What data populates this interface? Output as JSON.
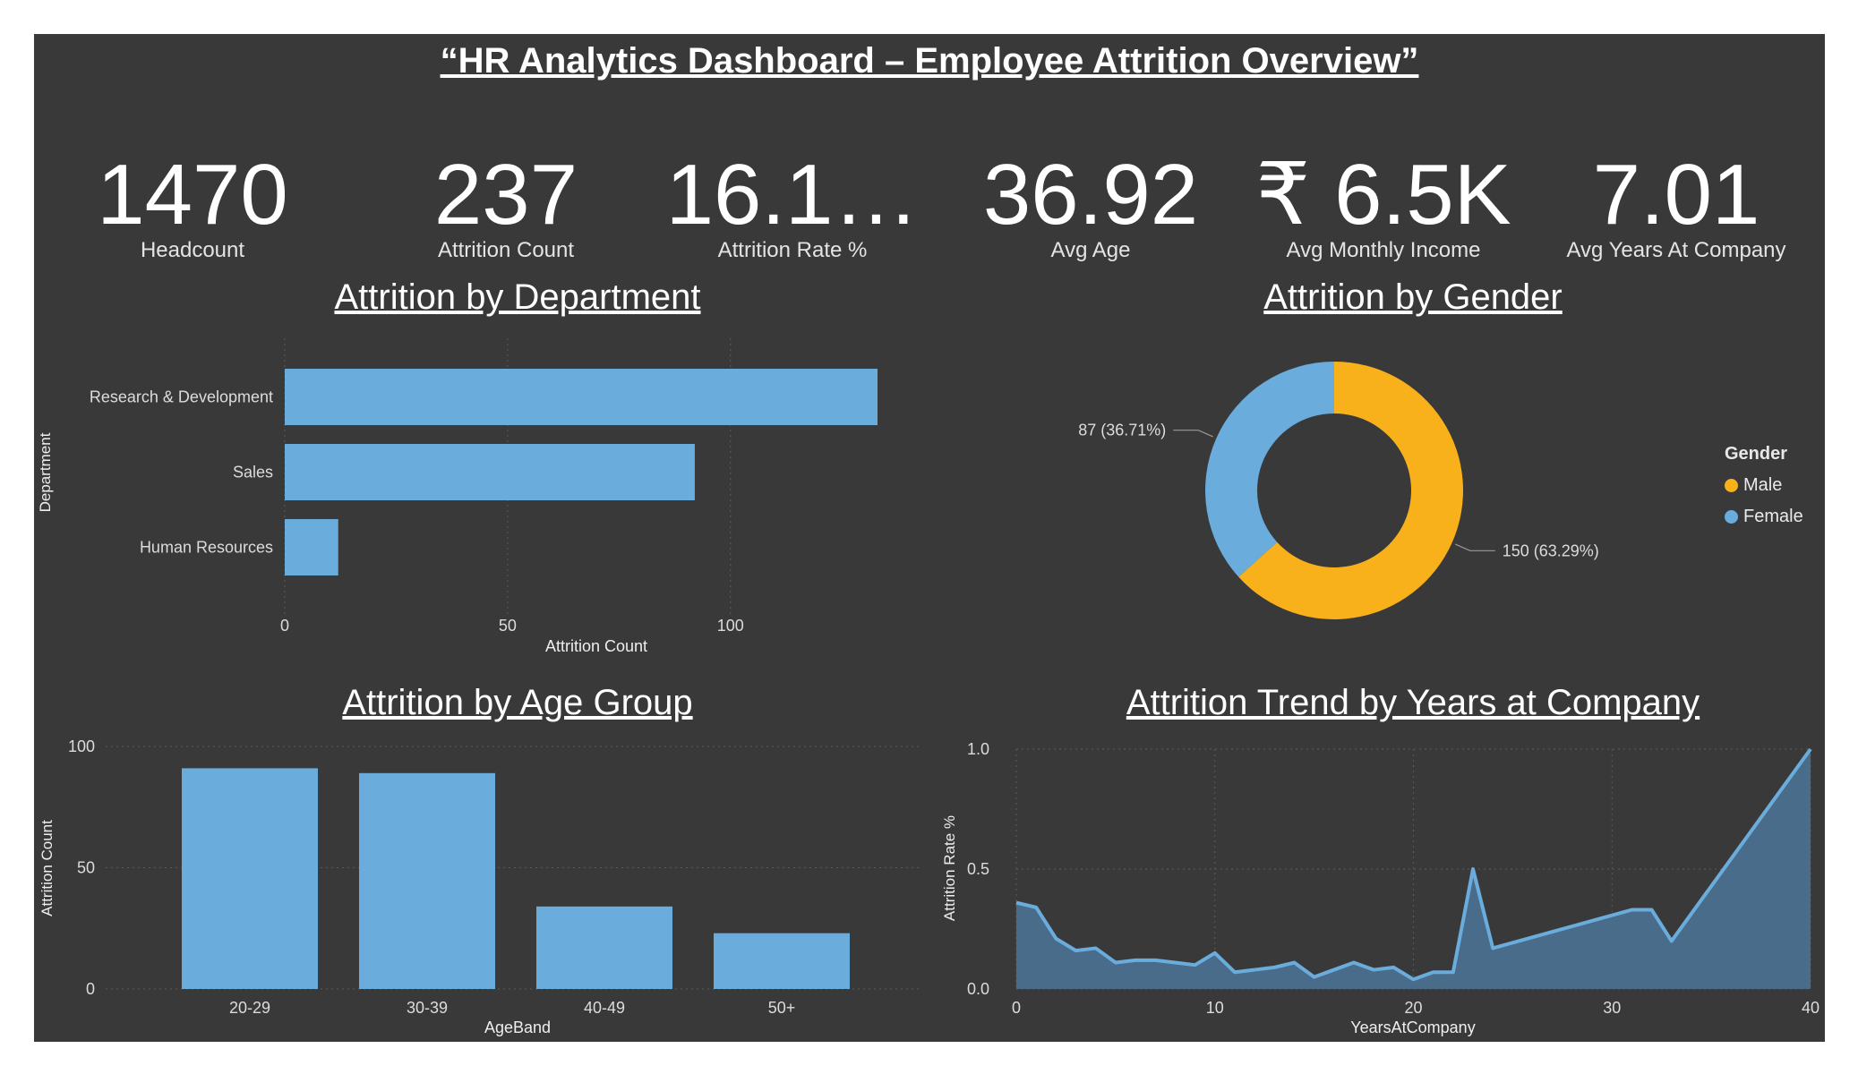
{
  "header": {
    "title": "“HR Analytics Dashboard – Employee Attrition Overview”"
  },
  "kpis": [
    {
      "value": "1470",
      "label": "Headcount"
    },
    {
      "value": "237",
      "label": "Attrition Count"
    },
    {
      "value": "16.1…",
      "label": "Attrition Rate %"
    },
    {
      "value": "36.92",
      "label": "Avg Age"
    },
    {
      "value": "₹ 6.5K",
      "label": "Avg Monthly Income"
    },
    {
      "value": "7.01",
      "label": "Avg Years At Company"
    }
  ],
  "colors": {
    "background": "#393939",
    "bar": "#6aacdc",
    "male": "#f9b11b",
    "female": "#6aacdc",
    "area": "#4a6f8e"
  },
  "chart_data": [
    {
      "type": "bar",
      "orientation": "horizontal",
      "title": "Attrition by Department",
      "categories": [
        "Research & Development",
        "Sales",
        "Human Resources"
      ],
      "values": [
        133,
        92,
        12
      ],
      "xlabel": "Attrition Count",
      "ylabel": "Department",
      "xticks": [
        "0",
        "50",
        "100"
      ],
      "xlim": [
        0,
        133
      ]
    },
    {
      "type": "pie",
      "title": "Attrition by Gender",
      "legend_title": "Gender",
      "legend_position": "right",
      "slices": [
        {
          "name": "Male",
          "value": 150,
          "label": "150 (63.29%)",
          "color": "#f9b11b"
        },
        {
          "name": "Female",
          "value": 87,
          "label": "87 (36.71%)",
          "color": "#6aacdc"
        }
      ]
    },
    {
      "type": "bar",
      "title": "Attrition by Age Group",
      "categories": [
        "20-29",
        "30-39",
        "40-49",
        "50+"
      ],
      "values": [
        91,
        89,
        34,
        23
      ],
      "xlabel": "AgeBand",
      "ylabel": "Attrition Count",
      "yticks": [
        "0",
        "50",
        "100"
      ],
      "ylim": [
        0,
        100
      ]
    },
    {
      "type": "area",
      "title": "Attrition Trend by Years at Company",
      "xlabel": "YearsAtCompany",
      "ylabel": "Attrition Rate %",
      "xticks": [
        "0",
        "10",
        "20",
        "30",
        "40"
      ],
      "yticks": [
        "0.0",
        "0.5",
        "1.0"
      ],
      "xlim": [
        0,
        40
      ],
      "ylim": [
        0,
        1
      ],
      "x": [
        0,
        1,
        2,
        3,
        4,
        5,
        6,
        7,
        8,
        9,
        10,
        11,
        12,
        13,
        14,
        15,
        16,
        17,
        18,
        19,
        20,
        21,
        22,
        23,
        24,
        31,
        32,
        33,
        40
      ],
      "y": [
        0.36,
        0.34,
        0.21,
        0.16,
        0.17,
        0.11,
        0.12,
        0.12,
        0.11,
        0.1,
        0.15,
        0.07,
        0.08,
        0.09,
        0.11,
        0.05,
        0.08,
        0.11,
        0.08,
        0.09,
        0.04,
        0.07,
        0.07,
        0.5,
        0.17,
        0.33,
        0.33,
        0.2,
        1.0
      ]
    }
  ]
}
